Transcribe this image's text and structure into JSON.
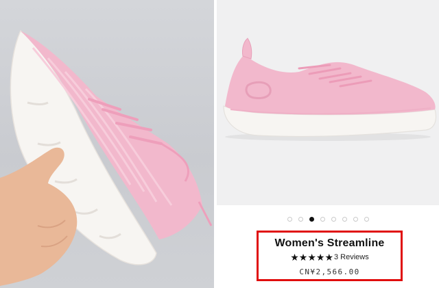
{
  "product": {
    "title": "Women's Streamline",
    "rating": {
      "stars_filled": 4,
      "stars_half": 1,
      "stars_text": "★★★★",
      "half_star_glyph": "★",
      "reviews_text": "3 Reviews"
    },
    "price": "CN¥2,566.00"
  },
  "carousel": {
    "total": 8,
    "active_index": 2
  },
  "colors": {
    "highlight_border": "#e00d0d",
    "shoe_pink": "#f2b8cc",
    "sole_white": "#f7f5f2"
  },
  "images": {
    "left": "hand-holding-pink-running-shoe-photo",
    "right": "pink-running-shoe-product-photo"
  }
}
